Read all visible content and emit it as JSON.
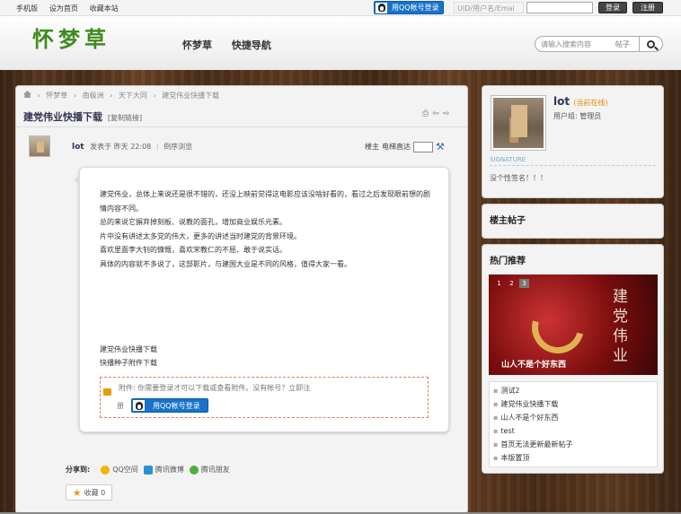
{
  "topbar": {
    "links": [
      "手机版",
      "设为首页",
      "收藏本站"
    ],
    "qq_login": "用QQ帐号登录",
    "uid_placeholder": "UID/用户名/Emai",
    "login": "登录",
    "register": "注册"
  },
  "header": {
    "logo": "怀梦草",
    "nav": [
      "怀梦草",
      "快捷导航"
    ],
    "search_placeholder": "请输入搜索内容",
    "search_category": "帖子"
  },
  "breadcrumb": [
    "怀梦草",
    "南极洲",
    "天下大同",
    "建党伟业快播下载"
  ],
  "thread": {
    "title": "建党伟业快播下载",
    "copy_link": "[复制链接]",
    "author": "lot",
    "posted": "发表于",
    "time": "昨天 22:08",
    "reverse": "倒序浏览",
    "floor": "楼主",
    "elevator": "电梯直达",
    "content": [
      "建党伟业，总体上来说还是很不错的，还没上映前觉得这电影应该没啥好看的，看过之后发现眼前想的剧情内容不同。",
      "总的来说它摒弃掉刻板、说教的面孔，增加商业娱乐元素。",
      "片中没有讲述太多党的伟大，更多的讲述当时建党的背景环境。",
      "喜欢里面李大钊的慷慨，喜欢宋教仁的不屈、敢于说实话。",
      "具体的内容就不多说了，这部影片，与建国大业是不同的风格，值得大家一看。"
    ],
    "download": [
      "建党伟业快播下载",
      "快播种子附件下载"
    ],
    "attach_notice": "附件: 你需要登录才可以下载或查看附件。没有帐号？立即注",
    "attach_reg": "册",
    "attach_login": "用QQ帐号登录",
    "share_label": "分享到:",
    "share": [
      "QQ空间",
      "腾讯微博",
      "腾讯朋友"
    ],
    "favorite": "收藏 0"
  },
  "user": {
    "name": "lot",
    "status": "(当前在线)",
    "group": "用户组: 管理员",
    "signature_label": "SIGNATURE",
    "signature": "没个性签名！！！"
  },
  "sidebar": {
    "floor_title": "楼主帖子",
    "hot_title": "热门推荐",
    "slides": [
      "1",
      "2",
      "3"
    ],
    "banner_text": "建党伟业",
    "banner_caption": "山人不是个好东西",
    "hot_list": [
      "测试2",
      "建党伟业快播下载",
      "山人不是个好东西",
      "test",
      "首页无法更新最新帖子",
      "本版置顶"
    ]
  },
  "colors": {
    "accent_blue": "#1a72c8",
    "logo_green": "#3f8a1f",
    "online_orange": "#e88a00"
  }
}
